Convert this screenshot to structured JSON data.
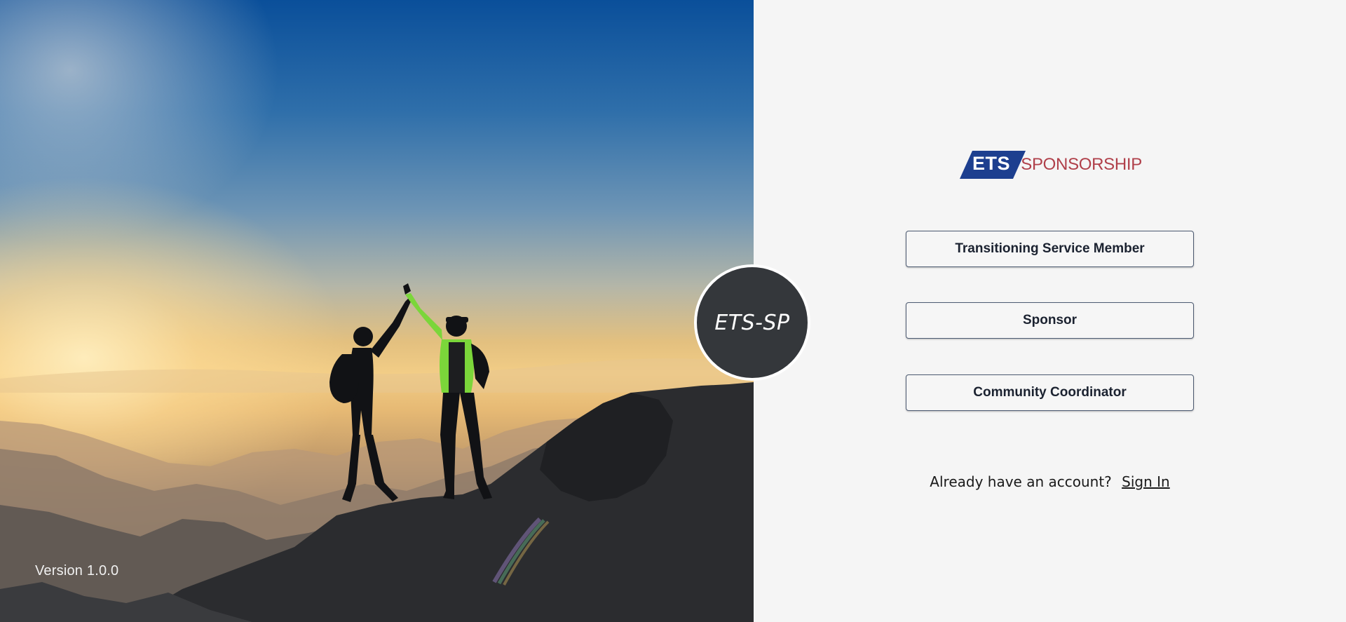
{
  "hero": {
    "image_alt": "two hikers high-five on a mountain at sunset",
    "version_label": "Version 1.0.0"
  },
  "badge": {
    "text": "ETS-SP"
  },
  "logo": {
    "mark_text": "ETS",
    "word_text": "SPONSORSHIP",
    "colors": {
      "mark": "#1d3f8f",
      "word": "#b0404a"
    }
  },
  "roles": {
    "transitioning_service_member": "Transitioning Service Member",
    "sponsor": "Sponsor",
    "community_coordinator": "Community Coordinator"
  },
  "signin": {
    "prompt": "Already have an account?",
    "link_label": "Sign In"
  },
  "colors": {
    "page_background": "#f5f5f5",
    "button_border": "#4d5b72",
    "badge_background": "#34373b"
  }
}
